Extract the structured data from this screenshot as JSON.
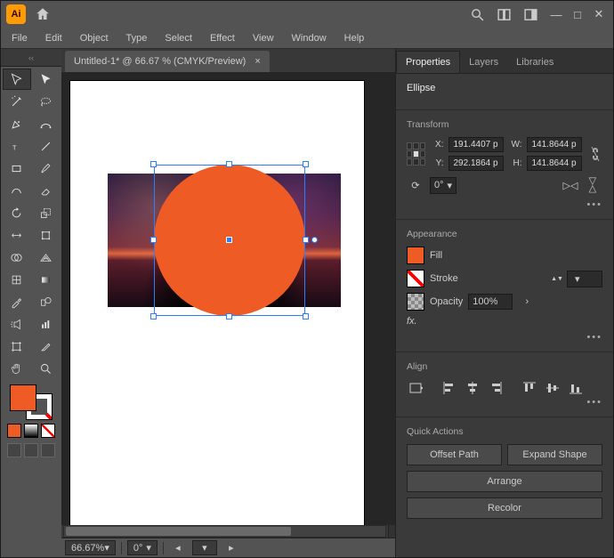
{
  "titlebar": {
    "app_abbrev": "Ai"
  },
  "menus": [
    "File",
    "Edit",
    "Object",
    "Type",
    "Select",
    "Effect",
    "View",
    "Window",
    "Help"
  ],
  "document": {
    "tab_label": "Untitled-1* @ 66.67 % (CMYK/Preview)",
    "close": "×"
  },
  "status": {
    "zoom": "66.67%",
    "rotate": "0°"
  },
  "panels": {
    "tabs": [
      "Properties",
      "Layers",
      "Libraries"
    ],
    "active": 0,
    "selection_type": "Ellipse",
    "transform": {
      "heading": "Transform",
      "x_label": "X:",
      "x": "191.4407 p",
      "y_label": "Y:",
      "y": "292.1864 p",
      "w_label": "W:",
      "w": "141.8644 p",
      "h_label": "H:",
      "h": "141.8644 p",
      "rotate": "0°"
    },
    "appearance": {
      "heading": "Appearance",
      "fill_label": "Fill",
      "stroke_label": "Stroke",
      "opacity_label": "Opacity",
      "opacity": "100%",
      "fx": "fx."
    },
    "align": {
      "heading": "Align"
    },
    "quick": {
      "heading": "Quick Actions",
      "offset": "Offset Path",
      "expand": "Expand Shape",
      "arrange": "Arrange",
      "recolor": "Recolor"
    }
  },
  "chart_data": null
}
